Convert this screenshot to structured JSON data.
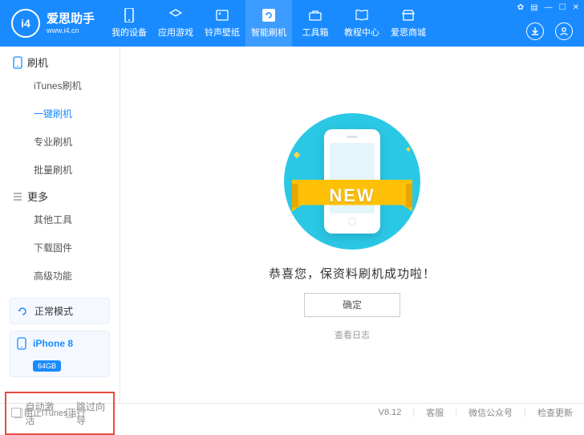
{
  "header": {
    "logo_badge": "i4",
    "logo_title": "爱思助手",
    "logo_sub": "www.i4.cn",
    "nav": [
      {
        "label": "我的设备"
      },
      {
        "label": "应用游戏"
      },
      {
        "label": "铃声壁纸"
      },
      {
        "label": "智能刷机",
        "active": true
      },
      {
        "label": "工具箱"
      },
      {
        "label": "教程中心"
      },
      {
        "label": "爱思商城"
      }
    ]
  },
  "sidebar": {
    "group1": "刷机",
    "items1": [
      {
        "label": "iTunes刷机"
      },
      {
        "label": "一键刷机",
        "active": true
      },
      {
        "label": "专业刷机"
      },
      {
        "label": "批量刷机"
      }
    ],
    "group2": "更多",
    "items2": [
      {
        "label": "其他工具"
      },
      {
        "label": "下载固件"
      },
      {
        "label": "高级功能"
      }
    ],
    "mode": "正常模式",
    "device": "iPhone 8",
    "storage": "64GB",
    "opt1": "自动激活",
    "opt2": "跳过向导"
  },
  "main": {
    "ribbon": "NEW",
    "success": "恭喜您，保资料刷机成功啦！",
    "confirm": "确定",
    "view_log": "查看日志"
  },
  "footer": {
    "block_itunes": "阻止iTunes运行",
    "version": "V8.12",
    "support": "客服",
    "wechat": "微信公众号",
    "update": "检查更新"
  }
}
